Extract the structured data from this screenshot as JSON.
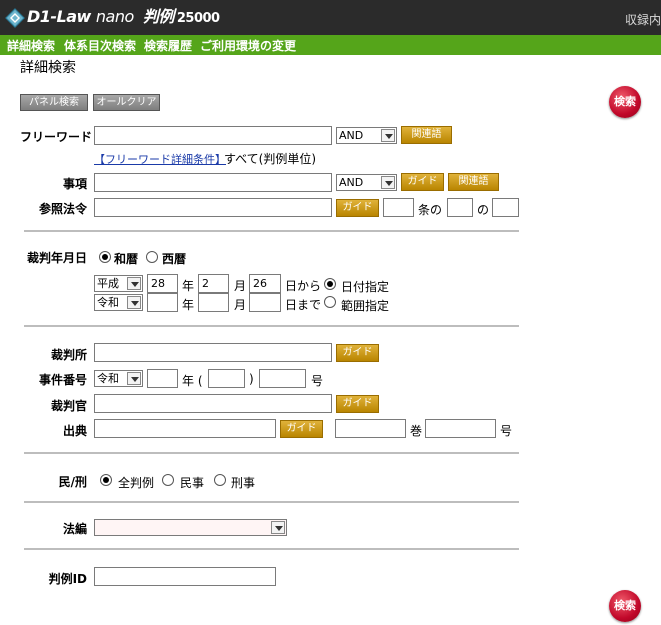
{
  "header": {
    "logo_text": "D1-Law",
    "logo_nano": "nano",
    "logo_product": "判例",
    "logo_number": "25000",
    "right_text": "収録内"
  },
  "menu": {
    "items": [
      "詳細検索",
      "体系目次検索",
      "検索履歴",
      "ご利用環境の変更"
    ]
  },
  "page": {
    "title": "詳細検索"
  },
  "buttons": {
    "panel_search": "パネル検索",
    "all_clear": "オールクリア",
    "search": "検索",
    "related_terms": "関連語",
    "guide": "ガイド"
  },
  "freeword": {
    "label": "フリーワード",
    "value": "",
    "operator": "AND",
    "detail_link": "【フリーワード詳細条件】",
    "scope": "すべて(判例単位)"
  },
  "matter": {
    "label": "事項",
    "value": "",
    "operator": "AND"
  },
  "law": {
    "label": "参照法令",
    "value": "",
    "article_label": "条の",
    "article_value": "",
    "sub_value": "",
    "no_label": "の"
  },
  "date": {
    "label": "裁判年月日",
    "era_wareki": "和暦",
    "era_seireki": "西暦",
    "era_selected": "wareki",
    "from": {
      "era": "平成",
      "year": "28",
      "year_label": "年",
      "month": "2",
      "month_label": "月",
      "day": "26",
      "suffix": "日から"
    },
    "to": {
      "era": "令和",
      "year": "",
      "year_label": "年",
      "month": "",
      "month_label": "月",
      "day": "",
      "suffix": "日まで"
    },
    "mode_date": "日付指定",
    "mode_range": "範囲指定",
    "mode_selected": "date"
  },
  "court": {
    "label": "裁判所",
    "value": ""
  },
  "case_number": {
    "label": "事件番号",
    "era": "令和",
    "year": "",
    "year_label": "年 (",
    "code": "",
    "close": ")",
    "num": "",
    "num_label": "号"
  },
  "judge": {
    "label": "裁判官",
    "value": ""
  },
  "source": {
    "label": "出典",
    "value": "",
    "volume": "",
    "volume_label": "巻",
    "number": "",
    "number_label": "号"
  },
  "civil_criminal": {
    "label": "民/刑",
    "all": "全判例",
    "civil": "民事",
    "criminal": "刑事",
    "selected": "all"
  },
  "law_field": {
    "label": "法編",
    "value": ""
  },
  "case_id": {
    "label": "判例ID",
    "value": ""
  }
}
